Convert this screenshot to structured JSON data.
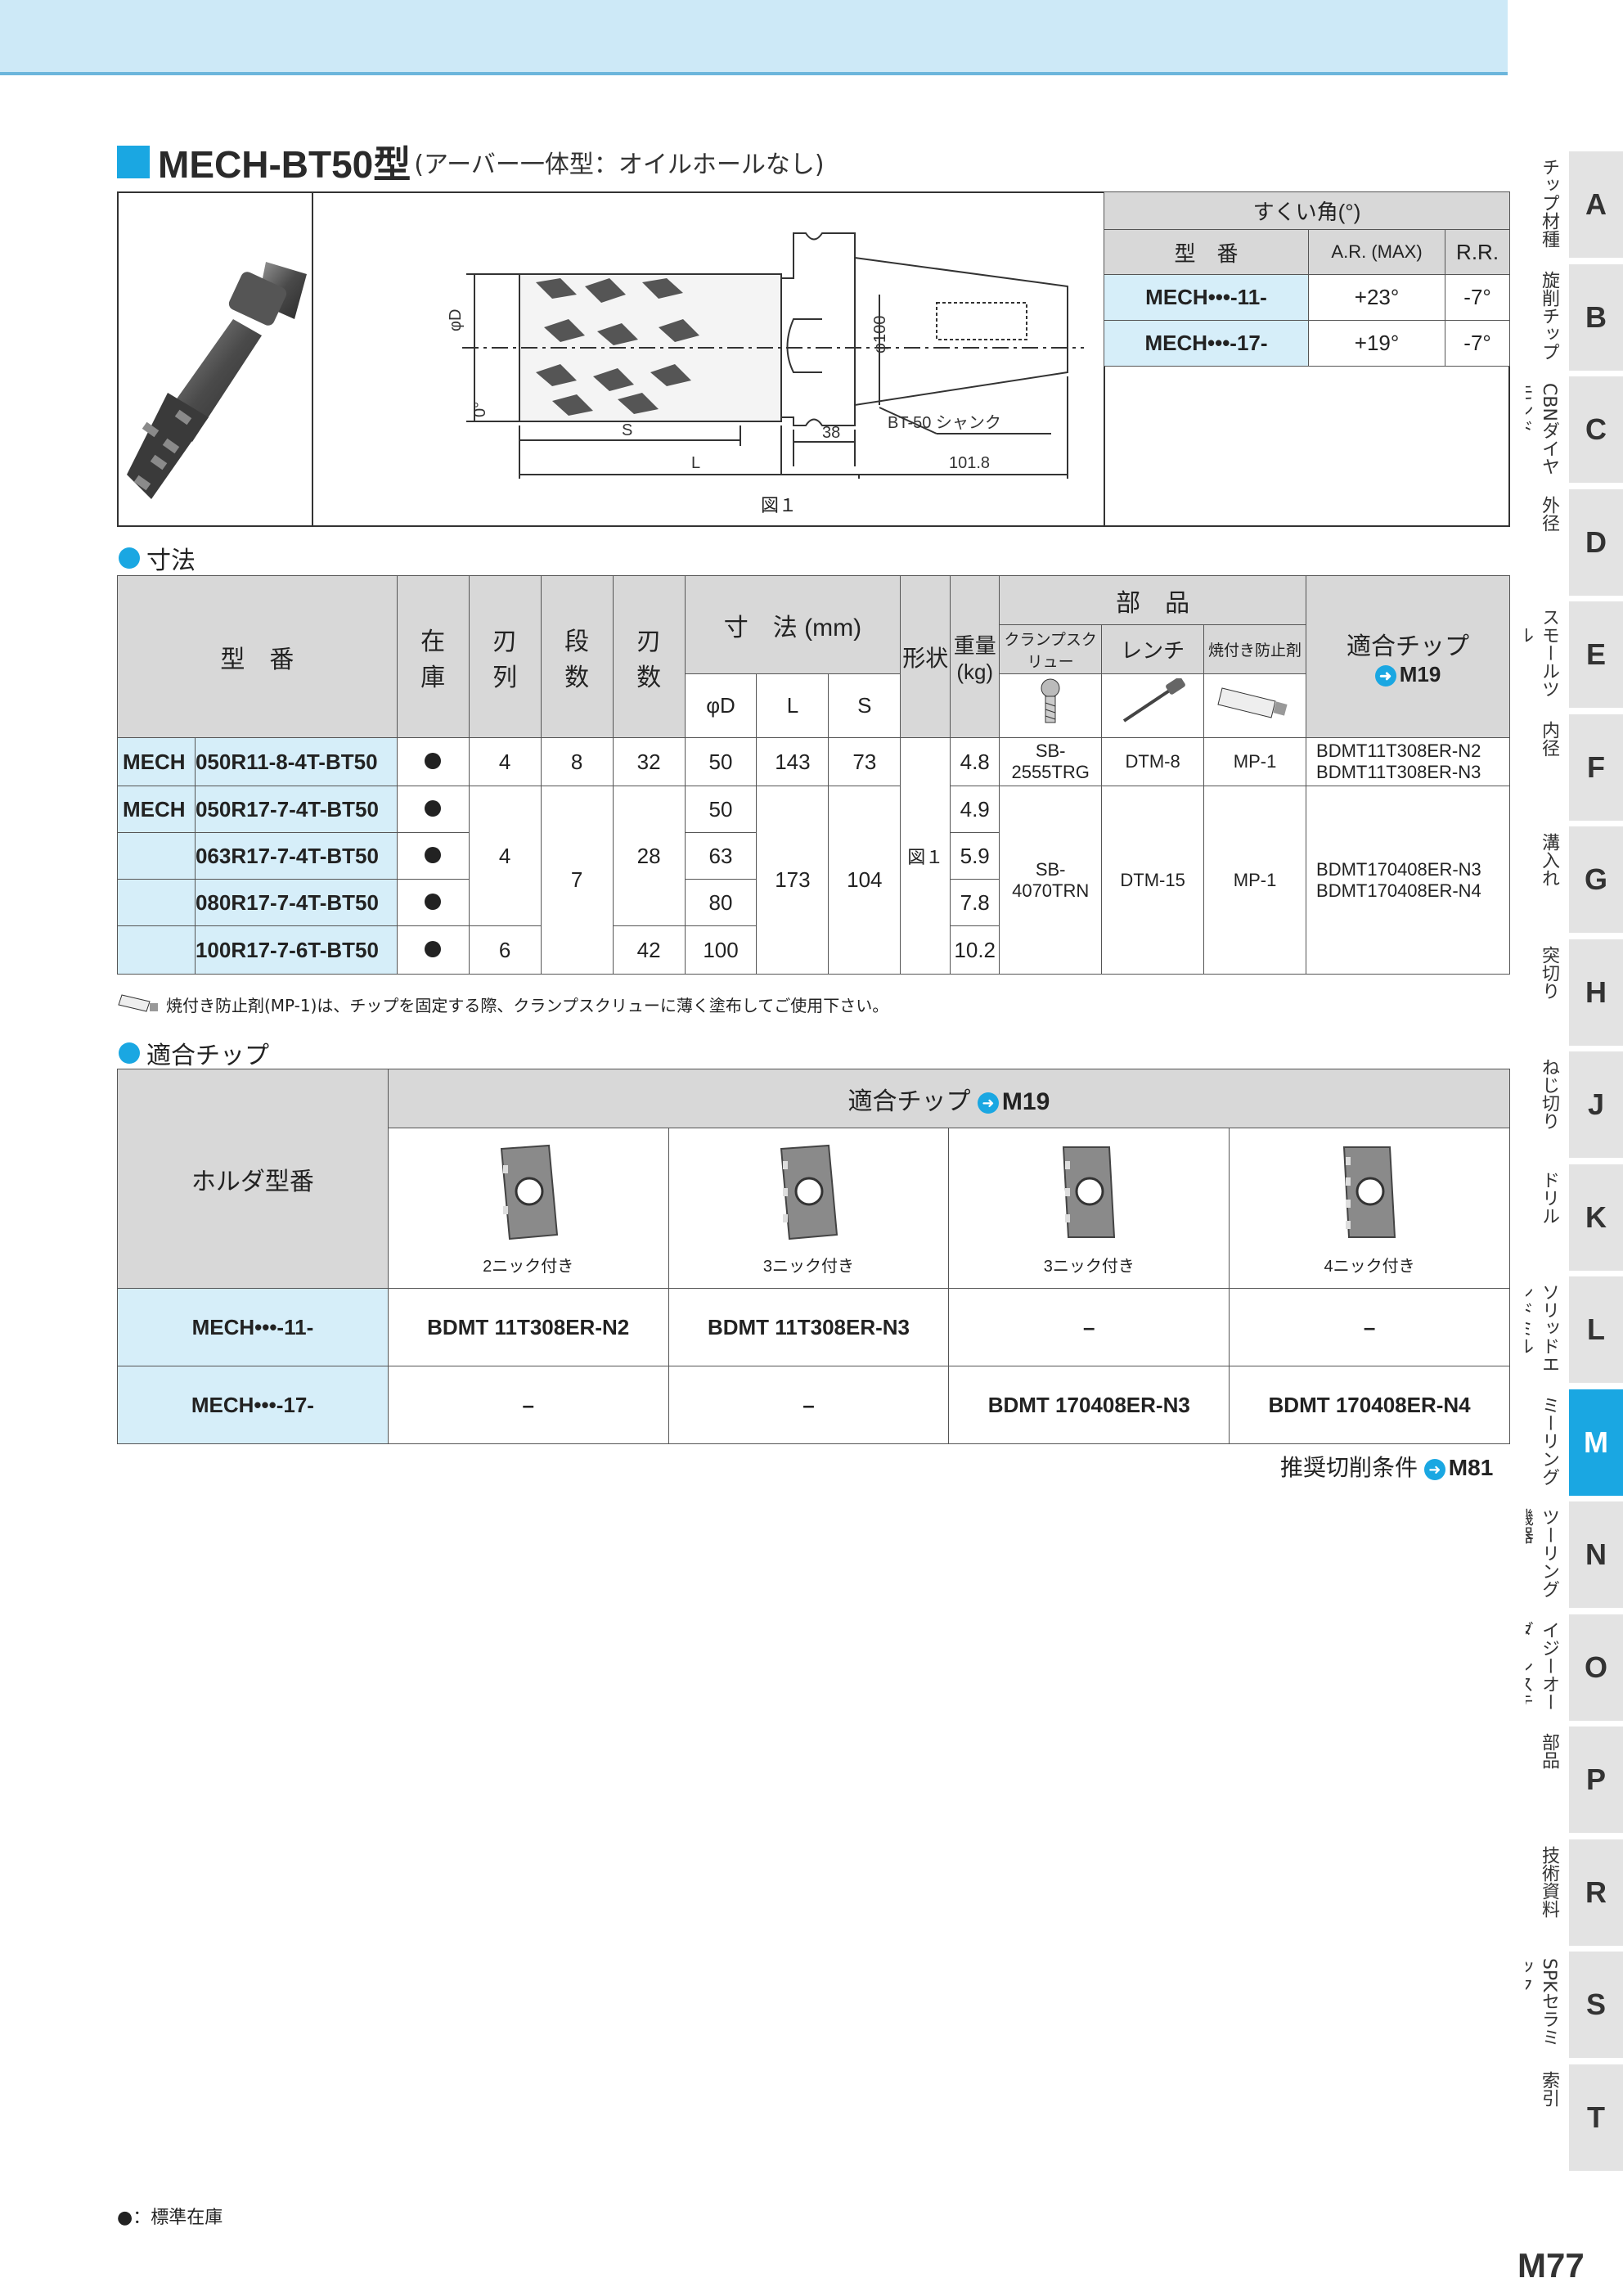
{
  "title": {
    "main": "MECH-BT50型",
    "sub": "(アーバー一体型：オイルホールなし)"
  },
  "figure": {
    "caption": "図１",
    "dim_phiD": "φD",
    "dim_angle": "0°",
    "dim_S": "S",
    "dim_L": "L",
    "dim_38": "38",
    "dim_1018": "101.8",
    "dim_phi100": "φ100",
    "shank_label": "BT-50 シャンク"
  },
  "rake": {
    "header": "すくい角(°)",
    "col_model": "型　番",
    "col_ar": "A.R. (MAX)",
    "col_rr": "R.R.",
    "rows": [
      {
        "model": "MECH•••-11-",
        "ar": "+23°",
        "rr": "-7°"
      },
      {
        "model": "MECH•••-17-",
        "ar": "+19°",
        "rr": "-7°"
      }
    ]
  },
  "dim_section": "寸法",
  "dim_table": {
    "h_model": "型　番",
    "h_stock": "在庫",
    "h_rows": "刃列",
    "h_stages": "段数",
    "h_teeth": "刃数",
    "h_dims": "寸　法 (mm)",
    "h_D": "φD",
    "h_L": "L",
    "h_S": "S",
    "h_shape": "形状",
    "h_weight": "重量(kg)",
    "h_parts": "部　品",
    "h_clamp": "クランプスクリュー",
    "h_wrench": "レンチ",
    "h_anti": "焼付き防止剤",
    "h_tip": "適合チップ",
    "h_tip_ref": "M19",
    "r1": {
      "prefix": "MECH",
      "model": "050R11-8-4T-BT50",
      "rows": "4",
      "stages": "8",
      "teeth": "32",
      "D": "50",
      "L": "143",
      "S": "73",
      "weight": "4.8",
      "clamp": "SB-2555TRG",
      "wrench": "DTM-8",
      "anti": "MP-1",
      "tip1": "BDMT11T308ER-N2",
      "tip2": "BDMT11T308ER-N3"
    },
    "r2": {
      "prefix": "MECH",
      "model": "050R17-7-4T-BT50",
      "D": "50",
      "weight": "4.9"
    },
    "r3": {
      "model": "063R17-7-4T-BT50",
      "D": "63",
      "weight": "5.9"
    },
    "r4": {
      "model": "080R17-7-4T-BT50",
      "D": "80",
      "weight": "7.8"
    },
    "r5": {
      "model": "100R17-7-6T-BT50",
      "rows": "6",
      "teeth": "42",
      "D": "100",
      "weight": "10.2"
    },
    "g_rows": "4",
    "g_stages": "7",
    "g_teeth": "28",
    "g_L": "173",
    "g_S": "104",
    "shape": "図１",
    "g_clamp": "SB-4070TRN",
    "g_wrench": "DTM-15",
    "g_anti": "MP-1",
    "g_tip1": "BDMT170408ER-N3",
    "g_tip2": "BDMT170408ER-N4"
  },
  "note": "焼付き防止剤(MP-1)は、チップを固定する際、クランプスクリューに薄く塗布してご使用下さい。",
  "chip_section": "適合チップ",
  "chip_table": {
    "h_holder": "ホルダ型番",
    "h_tip": "適合チップ",
    "h_ref": "M19",
    "captions": [
      "2ニック付き",
      "3ニック付き",
      "3ニック付き",
      "4ニック付き"
    ],
    "rows": [
      {
        "model": "MECH•••-11-",
        "cells": [
          "BDMT 11T308ER-N2",
          "BDMT 11T308ER-N3",
          "–",
          "–"
        ]
      },
      {
        "model": "MECH•••-17-",
        "cells": [
          "–",
          "–",
          "BDMT 170408ER-N3",
          "BDMT 170408ER-N4"
        ]
      }
    ]
  },
  "recommend": {
    "label": "推奨切削条件",
    "ref": "M81"
  },
  "legend": "●：標準在庫",
  "page": "M77",
  "tabs": [
    {
      "letter": "A",
      "label": "チップ材種"
    },
    {
      "letter": "B",
      "label": "旋削チップ"
    },
    {
      "letter": "C",
      "label": "CBNダイヤモンド"
    },
    {
      "letter": "D",
      "label": "外径"
    },
    {
      "letter": "E",
      "label": "スモールツール"
    },
    {
      "letter": "F",
      "label": "内径"
    },
    {
      "letter": "G",
      "label": "溝入れ"
    },
    {
      "letter": "H",
      "label": "突切り"
    },
    {
      "letter": "J",
      "label": "ねじ切り"
    },
    {
      "letter": "K",
      "label": "ドリル"
    },
    {
      "letter": "L",
      "label": "ソリッドエンドミル"
    },
    {
      "letter": "M",
      "label": "ミーリング"
    },
    {
      "letter": "N",
      "label": "ツーリング機器"
    },
    {
      "letter": "O",
      "label": "イジーオーダーシステム"
    },
    {
      "letter": "P",
      "label": "部品"
    },
    {
      "letter": "R",
      "label": "技術資料"
    },
    {
      "letter": "S",
      "label": "SPKセラミック"
    },
    {
      "letter": "T",
      "label": "索引"
    }
  ],
  "colors": {
    "accent": "#1aa7e2",
    "topbar": "#cde9f7",
    "header_gray": "#d8d8d8",
    "row_blue": "#d6eef9"
  }
}
